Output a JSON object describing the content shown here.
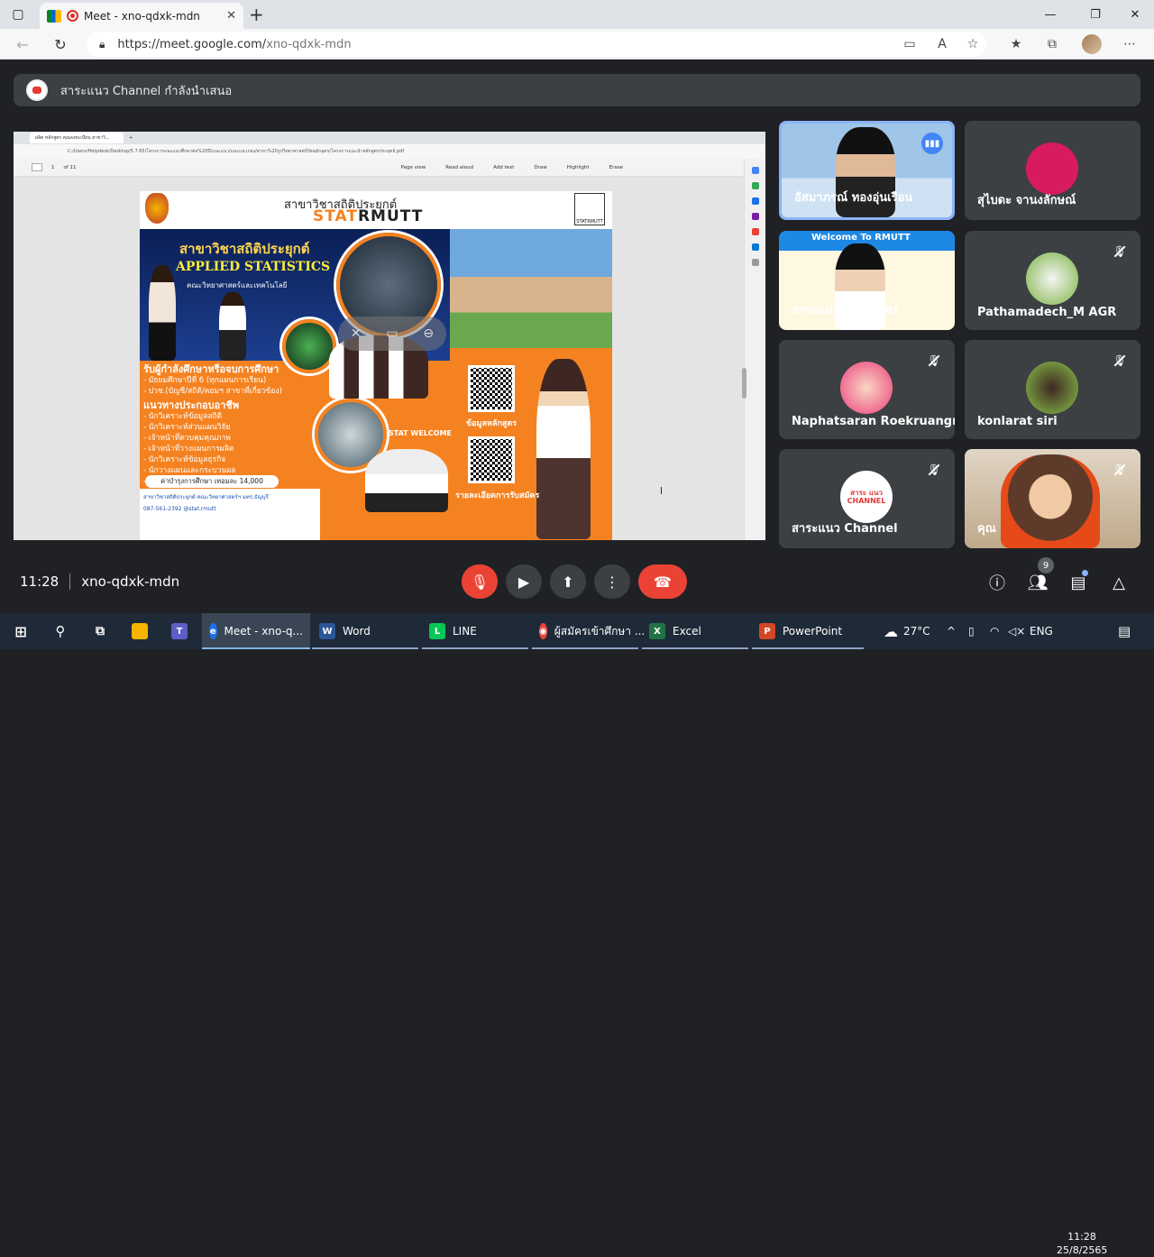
{
  "browser": {
    "tab_title": "Meet - xno-qdxk-mdn",
    "url_host": "https://meet.google.com/",
    "url_path": "xno-qdxk-mdn"
  },
  "presentation_banner": "สาระแนว Channel กำลังนำเสนอ",
  "shared_screen": {
    "tab_title": "ผลิต หลักสูตร คุณลงทะเบียน สาขาวิ...",
    "address": "C:/Users/Helpdesk/Desktop/5.7.65/โครงการแนะแนวศึกษาต่อ%20ปี/แนะแนว/แนะแนวกอง/สาขา%20รูปวิทยาศาสตร์ปัจฉมักอุดร/โครงการแนะนำหลักสูตรประยุทธ์.pdf",
    "page_num": "1",
    "page_total": "of 11",
    "tools": [
      "Page view",
      "Read aloud",
      "Add text",
      "Draw",
      "Highlight",
      "Erase"
    ],
    "poster": {
      "header_title": "สาขาวิชาสถิติประยุกต์",
      "header_brand_a": "STAT",
      "header_brand_b": "RMUTT",
      "sigma_label": "STATRMUTT",
      "thai_title": "สาขาวิชาสถิติประยุกต์",
      "eng_title": "APPLIED STATISTICS",
      "faculty": "คณะวิทยาศาสตร์และเทคโนโลยี",
      "recruit_head": "รับผู้กำลังศึกษาหรือจบการศึกษา",
      "recruit_items": [
        "- มัธยมศึกษาปีที่ 6 (ทุกแผนการเรียน)",
        "- ปวช.(บัญชี/สถิติ/คอมฯ สาขาที่เกี่ยวข้อง)"
      ],
      "career_head": "แนวทางประกอบอาชีพ",
      "career_items": [
        "- นักวิเคราะห์ข้อมูลสถิติ",
        "- นักวิเคราะห์ส่วนแผนวิจัย",
        "- เจ้าหน้าที่ควบคุมคุณภาพ",
        "- เจ้าหน้าที่วางแผนการผลิต",
        "- นักวิเคราะห์ข้อมูลธุรกิจ",
        "- นักวางแผนและกระบวนผล",
        "- ผู้ประกอบการ/เจ้าของธุรกิจ"
      ],
      "fee": "ค่าบำรุงการศึกษา เทอมละ 14,000",
      "contact_fb": "สาขาวิชาสถิติประยุกต์ คณะวิทยาศาสตร์ฯ มทร.ธัญบุรี",
      "contact_phone": "087-561-2392",
      "contact_line": "@stat.rmutt",
      "qr1_label": "ข้อมูลหลักสูตร",
      "qr2_label": "รายละเอียดการรับสมัคร",
      "welcome": "STAT WELCOME"
    }
  },
  "participants": [
    {
      "name": "อัสมาภรณ์ ทองอุ่นเรือน",
      "muted": false,
      "speaking": true
    },
    {
      "name": "สุไบดะ จานงลักษณ์",
      "muted": false,
      "speaking": false
    },
    {
      "name": "สาระแนว Channel",
      "muted": false,
      "speaking": false,
      "banner": "Welcome To RMUTT"
    },
    {
      "name": "Pathamadech_M AGR",
      "muted": true,
      "speaking": false
    },
    {
      "name": "Naphatsaran Roekruangrit",
      "muted": true,
      "speaking": false
    },
    {
      "name": "konlarat siri",
      "muted": true,
      "speaking": false
    },
    {
      "name": "สาระแนว Channel",
      "muted": true,
      "speaking": false,
      "logo_text": "สาระ แนว CHANNEL"
    },
    {
      "name": "คุณ",
      "muted": true,
      "speaking": false
    }
  ],
  "meeting": {
    "time": "11:28",
    "code": "xno-qdxk-mdn",
    "people_count": "9"
  },
  "taskbar": {
    "apps": [
      {
        "label": "Meet - xno-q...",
        "color": "#1a73e8"
      },
      {
        "label": "Word",
        "color": "#2b579a"
      },
      {
        "label": "LINE",
        "color": "#06c755"
      },
      {
        "label": "ผู้สมัครเข้าศึกษา ...",
        "color": "#e8453c"
      },
      {
        "label": "Excel",
        "color": "#217346"
      },
      {
        "label": "PowerPoint",
        "color": "#d24726"
      }
    ],
    "temperature": "27°C",
    "language": "ENG",
    "clock_time": "11:28",
    "clock_date": "25/8/2565"
  },
  "icons": {
    "mic": "mic-off-icon",
    "camera": "camera-icon",
    "present": "present-icon",
    "more": "more-icon",
    "hangup": "hangup-icon",
    "info": "info-icon",
    "people": "people-icon",
    "chat": "chat-icon",
    "activities": "activities-icon"
  }
}
